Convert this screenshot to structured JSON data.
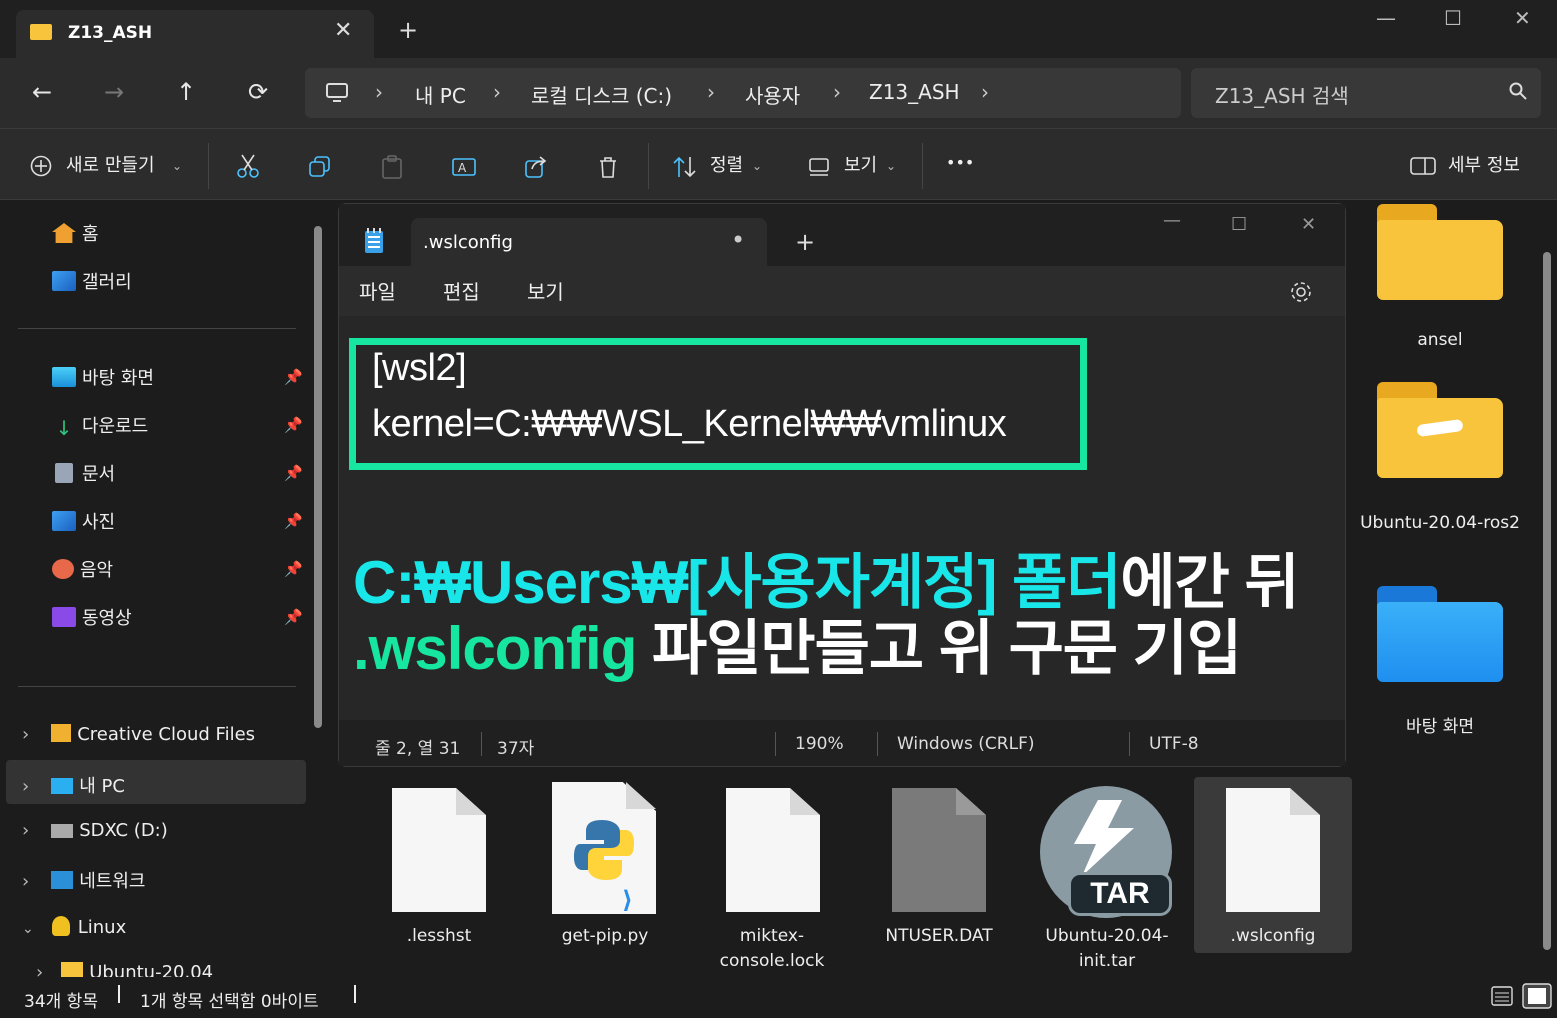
{
  "window": {
    "tab_title": "Z13_ASH",
    "new_tab": "+",
    "minimize": "—",
    "maximize": "☐",
    "close": "✕",
    "tab_close": "✕"
  },
  "nav": {
    "back": "←",
    "forward": "→",
    "up": "↑",
    "refresh": "⟳",
    "breadcrumbs": [
      "내 PC",
      "로컬 디스크 (C:)",
      "사용자",
      "Z13_ASH"
    ],
    "separator": "›",
    "search_placeholder": "Z13_ASH 검색"
  },
  "toolbar": {
    "new": "새로 만들기",
    "sort": "정렬",
    "view": "보기",
    "more": "•••",
    "details": "세부 정보"
  },
  "sidebar": {
    "top": [
      {
        "label": "홈"
      },
      {
        "label": "갤러리"
      }
    ],
    "pinned": [
      {
        "label": "바탕 화면"
      },
      {
        "label": "다운로드"
      },
      {
        "label": "문서"
      },
      {
        "label": "사진"
      },
      {
        "label": "음악"
      },
      {
        "label": "동영상"
      }
    ],
    "tree": [
      {
        "label": "Creative Cloud Files"
      },
      {
        "label": "내 PC"
      },
      {
        "label": "SDXC (D:)"
      },
      {
        "label": "네트워크"
      },
      {
        "label": "Linux"
      },
      {
        "label": "Ubuntu-20.04"
      }
    ]
  },
  "notepad": {
    "tab_title": ".wslconfig",
    "menu": [
      "파일",
      "편집",
      "보기"
    ],
    "lines": [
      "[wsl2]",
      "kernel=C:₩₩WSL_Kernel₩₩vmlinux"
    ],
    "annotation": {
      "line1_cyan": "C:₩Users₩[사용자계정] 폴더",
      "line1_white": "에간 뒤",
      "line2_green": ".wslconfig",
      "line2_white": " 파일만들고 위 구문 기입"
    },
    "status": {
      "position": "줄 2, 열 31",
      "chars": "37자",
      "zoom": "190%",
      "eol": "Windows (CRLF)",
      "encoding": "UTF-8"
    }
  },
  "right_items": [
    {
      "name": "ansel"
    },
    {
      "name": "Ubuntu-20.04-ros2"
    },
    {
      "name": "바탕 화면"
    }
  ],
  "files": [
    {
      "name": ".lesshst"
    },
    {
      "name": "get-pip.py"
    },
    {
      "name": "miktex-console.lock"
    },
    {
      "name": "NTUSER.DAT"
    },
    {
      "name": "Ubuntu-20.04-init.tar"
    },
    {
      "name": ".wslconfig"
    }
  ],
  "tar_badge": "TAR",
  "status": {
    "count": "34개 항목",
    "selected": "1개 항목 선택함 0바이트"
  },
  "colors": {
    "highlight_green": "#16e6a0",
    "annotation_cyan": "#19e6e8",
    "folder_yellow": "#f8c43c",
    "folder_blue": "#1f8ff0"
  }
}
